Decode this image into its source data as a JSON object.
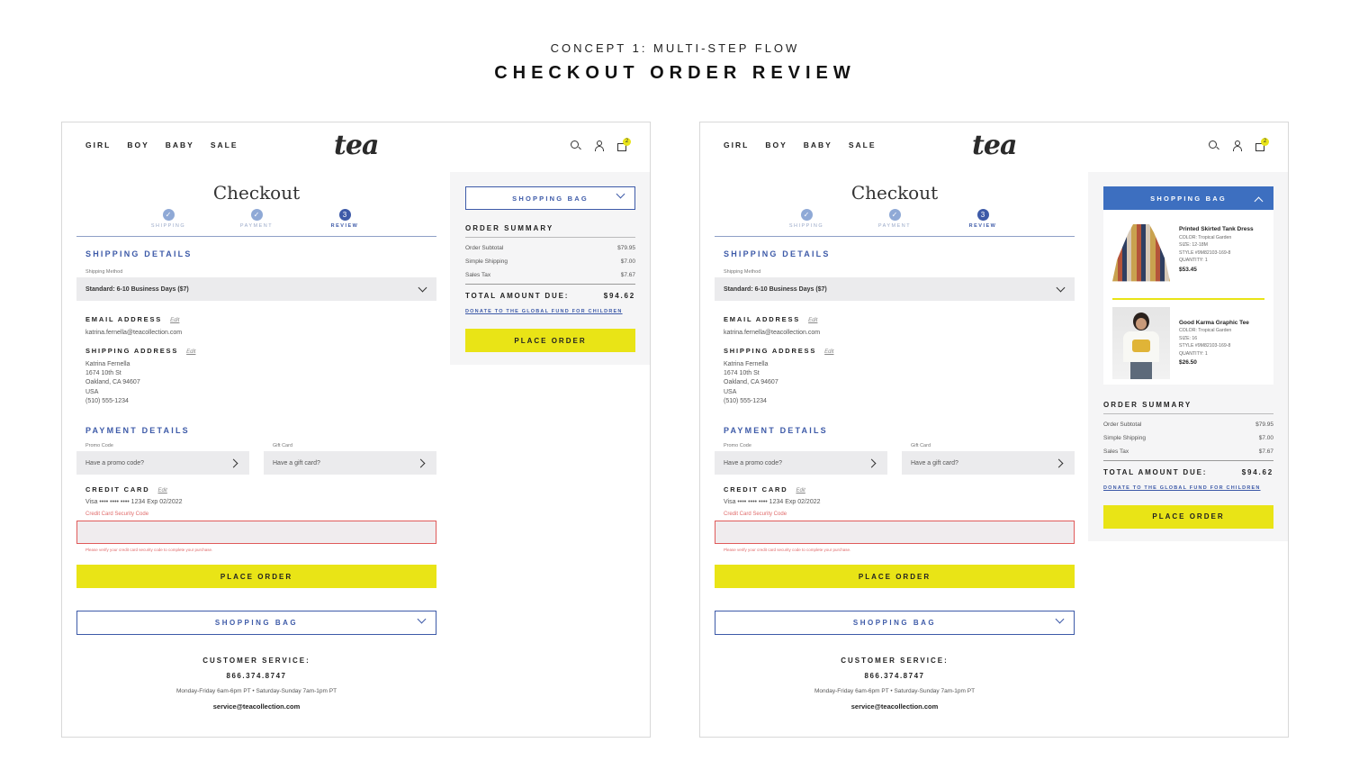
{
  "heading": {
    "subtitle": "CONCEPT 1: MULTI-STEP FLOW",
    "title": "CHECKOUT ORDER REVIEW"
  },
  "site": {
    "nav": [
      "GIRL",
      "BOY",
      "BABY",
      "SALE"
    ],
    "logo": "tea",
    "cart_count": "2",
    "icons": [
      "search-icon",
      "user-icon",
      "bag-icon"
    ]
  },
  "checkout": {
    "title": "Checkout",
    "steps": [
      {
        "label": "SHIPPING",
        "state": "done"
      },
      {
        "label": "PAYMENT",
        "state": "done"
      },
      {
        "label": "REVIEW",
        "number": "3",
        "state": "active"
      }
    ],
    "shipping_details_heading": "SHIPPING DETAILS",
    "shipping_method_label": "Shipping Method",
    "shipping_method_value": "Standard: 6-10 Business Days ($7)",
    "email_label": "EMAIL ADDRESS",
    "edit_label": "Edit",
    "email_value": "katrina.fernella@teacollection.com",
    "shipping_address_label": "SHIPPING ADDRESS",
    "address_lines": [
      "Katrina Fernella",
      "1674 10th St",
      "Oakland, CA 94607",
      "USA",
      "(510) 555-1234"
    ],
    "payment_details_heading": "PAYMENT DETAILS",
    "promo_label": "Promo Code",
    "promo_placeholder": "Have a promo code?",
    "gift_label": "Gift Card",
    "gift_placeholder": "Have a gift card?",
    "credit_card_label": "CREDIT CARD",
    "credit_card_value": "Visa •••• •••• •••• 1234 Exp 02/2022",
    "security_code_label": "Credit Card Security Code",
    "security_code_error": "Please verify your credit card security code to complete your purchase.",
    "place_order": "PLACE ORDER",
    "shopping_bag": "SHOPPING BAG"
  },
  "customer_service": {
    "label": "CUSTOMER SERVICE:",
    "phone": "866.374.8747",
    "hours": "Monday-Friday 6am-6pm PT • Saturday-Sunday 7am-1pm PT",
    "email": "service@teacollection.com"
  },
  "summary": {
    "shopping_bag": "SHOPPING BAG",
    "heading": "ORDER SUMMARY",
    "rows": [
      {
        "label": "Order Subtotal",
        "value": "$79.95"
      },
      {
        "label": "Simple Shipping",
        "value": "$7.00"
      },
      {
        "label": "Sales Tax",
        "value": "$7.67"
      }
    ],
    "total_label": "TOTAL AMOUNT DUE:",
    "total_value": "$94.62",
    "donate": "DONATE TO THE GLOBAL FUND FOR CHILDREN",
    "place_order": "PLACE ORDER"
  },
  "bag_items": [
    {
      "name": "Printed Skirted Tank Dress",
      "color": "COLOR: Tropical Garden",
      "size": "SIZE: 12-18M",
      "style": "STYLE #9M82103-169-8",
      "quantity": "QUANTITY: 1",
      "price": "$53.45"
    },
    {
      "name": "Good Karma Graphic Tee",
      "color": "COLOR: Tropical Garden",
      "size": "SIZE: 16",
      "style": "STYLE #9M82103-169-8",
      "quantity": "QUANTITY: 1",
      "price": "$26.50"
    }
  ],
  "colors": {
    "accent_blue": "#3d5aa8",
    "accent_yellow": "#e9e416",
    "error_red": "#e05a5a"
  }
}
